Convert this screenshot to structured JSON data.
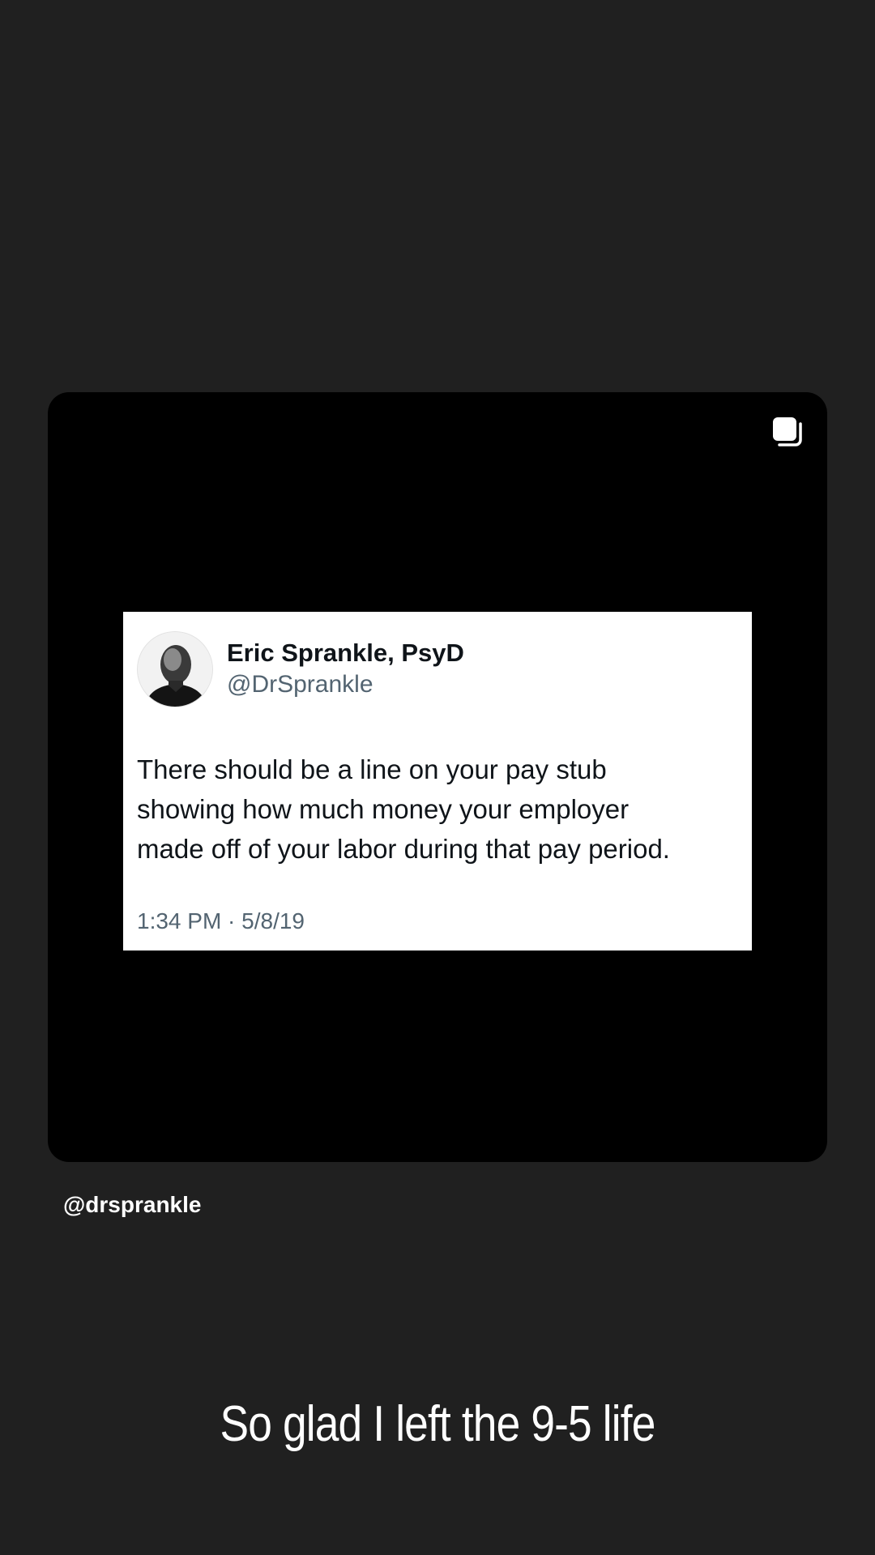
{
  "post": {
    "multi_icon": "multiple-posts-icon",
    "tweet": {
      "avatar_icon": "profile-photo",
      "name": "Eric Sprankle, PsyD",
      "handle": "@DrSprankle",
      "text_lines": [
        "There should be a line on your pay stub",
        "showing how much money your employer",
        "made off of your labor during that pay period."
      ],
      "timestamp": "1:34 PM · 5/8/19"
    }
  },
  "mention": "@drsprankle",
  "caption": "So glad I left the 9-5 life",
  "colors": {
    "background": "#202020",
    "card": "#000000",
    "tweet_bg": "#ffffff",
    "tweet_secondary": "#536471"
  }
}
